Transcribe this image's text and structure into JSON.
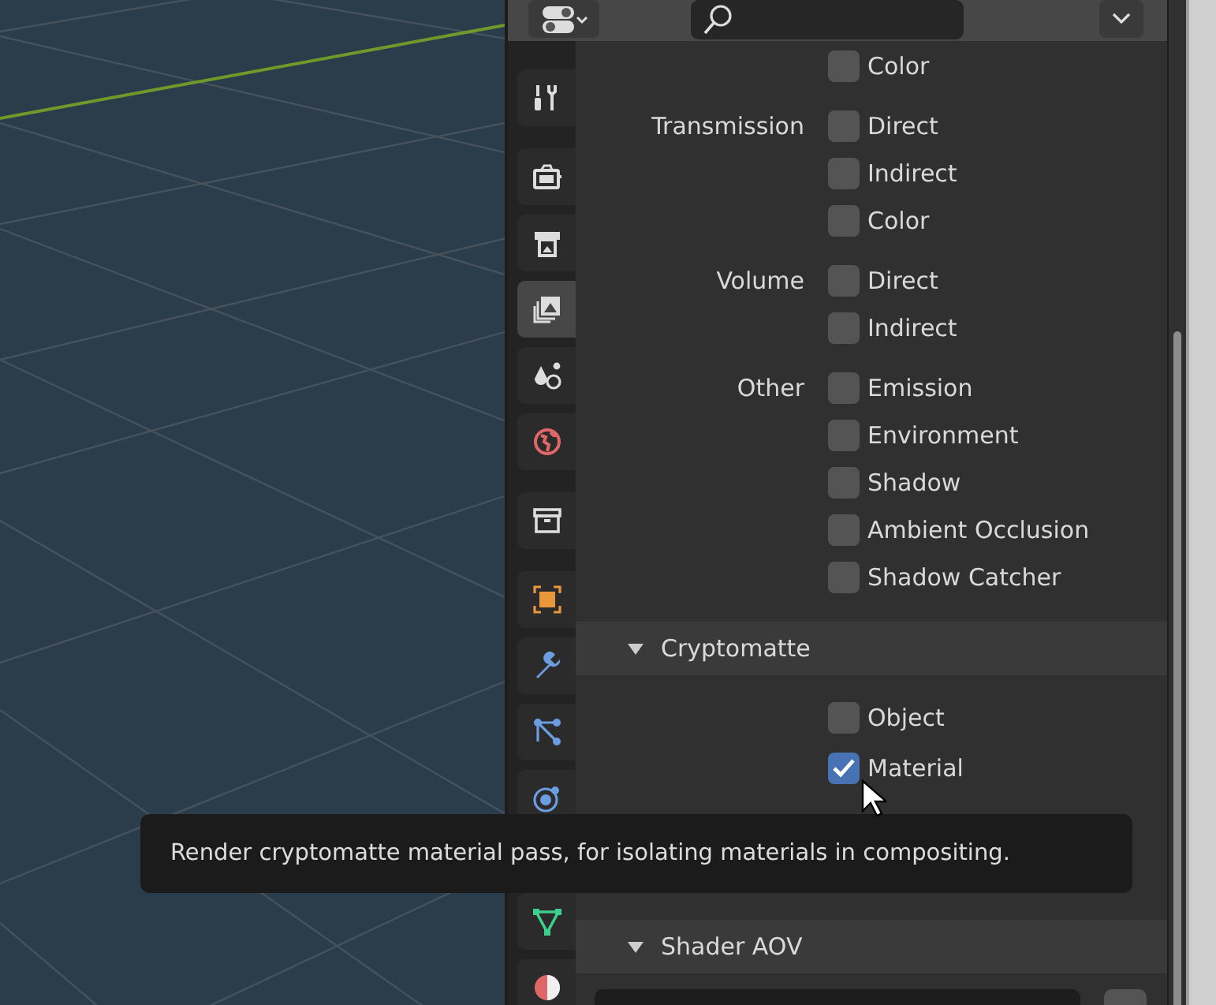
{
  "tab_groups": [
    {
      "tabs": [
        {
          "kind": "tool",
          "selected": false
        }
      ]
    },
    {
      "tabs": [
        {
          "kind": "render",
          "selected": false
        },
        {
          "kind": "output",
          "selected": false
        },
        {
          "kind": "view_layer",
          "selected": true
        },
        {
          "kind": "scene",
          "selected": false
        },
        {
          "kind": "world",
          "selected": false
        }
      ]
    },
    {
      "tabs": [
        {
          "kind": "collection",
          "selected": false
        }
      ]
    },
    {
      "tabs": [
        {
          "kind": "object",
          "selected": false
        },
        {
          "kind": "modifier",
          "selected": false
        },
        {
          "kind": "particles",
          "selected": false
        },
        {
          "kind": "physics",
          "selected": false
        }
      ]
    },
    {
      "tabs": [
        {
          "kind": "data",
          "selected": false
        },
        {
          "kind": "material",
          "selected": false
        }
      ]
    }
  ],
  "pass_groups": [
    {
      "items": [
        {
          "label": "Color",
          "checked": false
        }
      ]
    },
    {
      "label": "Transmission",
      "items": [
        {
          "label": "Direct",
          "checked": false
        },
        {
          "label": "Indirect",
          "checked": false
        },
        {
          "label": "Color",
          "checked": false
        }
      ]
    },
    {
      "label": "Volume",
      "items": [
        {
          "label": "Direct",
          "checked": false
        },
        {
          "label": "Indirect",
          "checked": false
        }
      ]
    },
    {
      "label": "Other",
      "items": [
        {
          "label": "Emission",
          "checked": false
        },
        {
          "label": "Environment",
          "checked": false
        },
        {
          "label": "Shadow",
          "checked": false
        },
        {
          "label": "Ambient Occlusion",
          "checked": false
        },
        {
          "label": "Shadow Catcher",
          "checked": false
        }
      ]
    }
  ],
  "cryptomatte": {
    "title": "Cryptomatte",
    "expanded": true,
    "items": [
      {
        "label": "Object",
        "checked": false
      },
      {
        "label": "Material",
        "checked": true
      }
    ]
  },
  "shader_aov": {
    "title": "Shader AOV",
    "expanded": true
  },
  "tooltip": {
    "text": "Render cryptomatte material pass, for isolating materials in compositing."
  }
}
